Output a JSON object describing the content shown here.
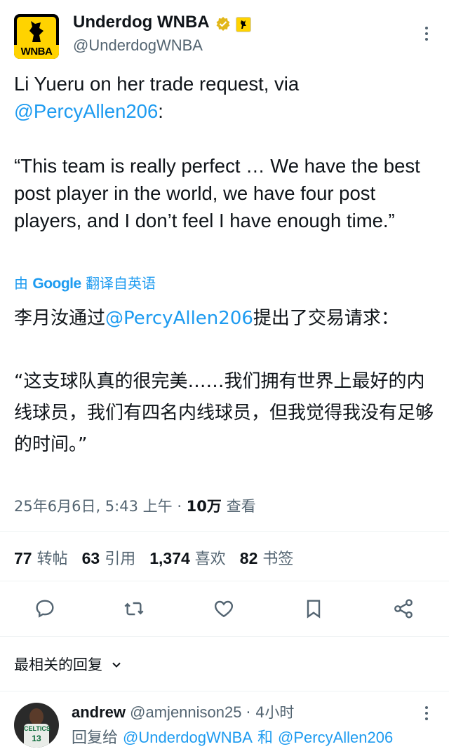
{
  "tweet": {
    "display_name": "Underdog WNBA",
    "handle": "@UnderdogWNBA",
    "logo_text": "WNBA",
    "text_en_line1": "Li Yueru on her trade request, via",
    "text_en_mention": "@PercyAllen206",
    "text_en_colon": ":",
    "text_en_quote": "“This team is really perfect … We have the best post player in the world, we have four post players, and I don’t feel I have enough time.”",
    "translate_prefix": "由",
    "translate_brand": "Google",
    "translate_suffix": "翻译自英语",
    "text_zh_start": "李月汝通过",
    "text_zh_mention": "@PercyAllen206",
    "text_zh_end": "提出了交易请求：",
    "text_zh_quote": "“这支球队真的很完美……我们拥有世界上最好的内线球员，我们有四名内线球员，但我觉得我没有足够的时间。”",
    "timestamp": "25年6月6日, 5:43 上午",
    "dot": " · ",
    "views_count": "10万",
    "views_label": " 查看"
  },
  "stats": [
    {
      "count": "77",
      "label": "转帖"
    },
    {
      "count": "63",
      "label": "引用"
    },
    {
      "count": "1,374",
      "label": "喜欢"
    },
    {
      "count": "82",
      "label": "书签"
    }
  ],
  "actions": [
    "reply-icon",
    "retweet-icon",
    "like-icon",
    "bookmark-icon",
    "share-icon"
  ],
  "sort_label": "最相关的回复",
  "reply": {
    "name": "andrew",
    "handle": "@amjennison25",
    "time": "· 4小时",
    "replying_prefix": "回复给",
    "replying_user1": "@UnderdogWNBA",
    "replying_and": "和",
    "replying_user2": "@PercyAllen206",
    "jersey_text": "CELTICS",
    "jersey_number": "13"
  },
  "colors": {
    "accent": "#1d9bf0",
    "muted": "#536471",
    "text": "#0f1419",
    "brand_yellow": "#ffd300"
  }
}
